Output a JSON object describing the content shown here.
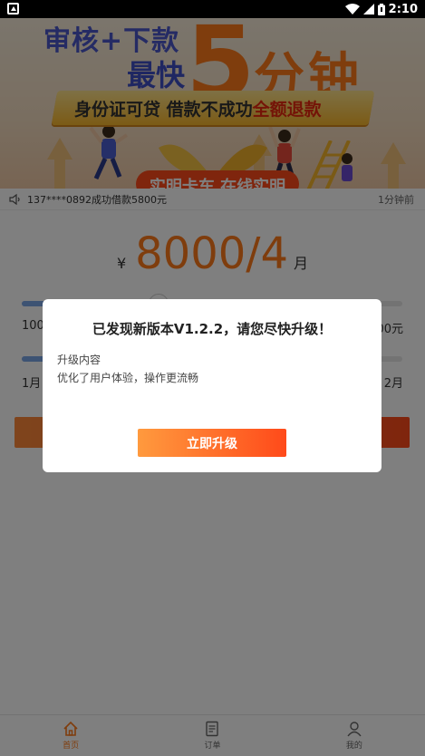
{
  "status_bar": {
    "time": "2:10",
    "icons": [
      "android-notification-icon",
      "wifi-icon",
      "signal-icon",
      "battery-icon"
    ]
  },
  "banner": {
    "line1": "审核+下款",
    "line2": "最快",
    "big_number": "5",
    "minutes": "分钟",
    "ribbon_normal": "身份证可贷  借款不成功",
    "ribbon_highlight": "全额退款",
    "bottom_partial": "实明卡车 在线实明"
  },
  "notice": {
    "text": "137****0892成功借款5800元",
    "time": "1分钟前"
  },
  "loan": {
    "currency": "¥",
    "amount": "8000/4",
    "unit": "月",
    "amount_min_label": "100",
    "amount_max_label": "00元",
    "term_min_label": "1月",
    "term_max_label": "2月",
    "amount_level": 0.36,
    "term_level": 0.28
  },
  "tabs": [
    {
      "label": "首页",
      "icon": "home-icon",
      "active": true
    },
    {
      "label": "订单",
      "icon": "document-icon",
      "active": false
    },
    {
      "label": "我的",
      "icon": "user-icon",
      "active": false
    }
  ],
  "dialog": {
    "title": "已发现新版本V1.2.2，请您尽快升级！",
    "subtitle": "升级内容",
    "description": "优化了用户体验，操作更流畅",
    "button_label": "立即升级"
  },
  "colors": {
    "accent": "#ff7a1a",
    "button_gradient_start": "#ff9a3e",
    "button_gradient_end": "#ff4a1a",
    "banner_blue": "#4a57c9",
    "slider_fill": "#7aa6e6"
  }
}
